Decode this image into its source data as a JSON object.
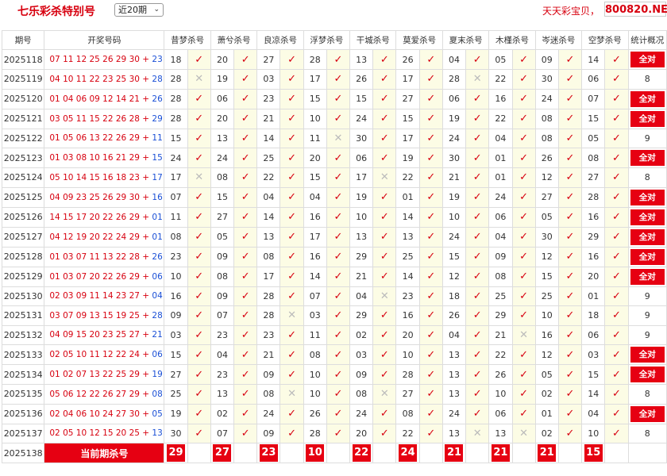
{
  "header": {
    "title": "七乐彩杀特别号",
    "period_select": "近20期",
    "slogan": "天天彩宝贝，",
    "site": "800820.NET"
  },
  "columns": [
    "期号",
    "开奖号码",
    "昔梦杀号",
    "萧兮杀号",
    "良凉杀号",
    "浮梦杀号",
    "干城杀号",
    "莫爱杀号",
    "夏末杀号",
    "木槿杀号",
    "岑迷杀号",
    "空梦杀号",
    "统计概况"
  ],
  "rows": [
    {
      "issue": "2025118",
      "draw": "07 11 12 25 26 29 30",
      "special": "23",
      "kills": [
        [
          "18",
          "hit"
        ],
        [
          "20",
          "hit"
        ],
        [
          "27",
          "hit"
        ],
        [
          "28",
          "hit"
        ],
        [
          "13",
          "hit"
        ],
        [
          "26",
          "hit"
        ],
        [
          "04",
          "hit"
        ],
        [
          "05",
          "hit"
        ],
        [
          "09",
          "hit"
        ],
        [
          "14",
          "hit"
        ]
      ],
      "stat": "全对"
    },
    {
      "issue": "2025119",
      "draw": "04 10 11 22 23 25 30",
      "special": "28",
      "kills": [
        [
          "28",
          "miss"
        ],
        [
          "19",
          "hit"
        ],
        [
          "03",
          "hit"
        ],
        [
          "17",
          "hit"
        ],
        [
          "26",
          "hit"
        ],
        [
          "17",
          "hit"
        ],
        [
          "28",
          "miss"
        ],
        [
          "22",
          "hit"
        ],
        [
          "30",
          "hit"
        ],
        [
          "06",
          "hit"
        ]
      ],
      "stat": "8"
    },
    {
      "issue": "2025120",
      "draw": "01 04 06 09 12 14 21",
      "special": "26",
      "kills": [
        [
          "28",
          "hit"
        ],
        [
          "06",
          "hit"
        ],
        [
          "23",
          "hit"
        ],
        [
          "15",
          "hit"
        ],
        [
          "15",
          "hit"
        ],
        [
          "27",
          "hit"
        ],
        [
          "06",
          "hit"
        ],
        [
          "16",
          "hit"
        ],
        [
          "24",
          "hit"
        ],
        [
          "07",
          "hit"
        ]
      ],
      "stat": "全对"
    },
    {
      "issue": "2025121",
      "draw": "03 05 11 15 22 26 28",
      "special": "29",
      "kills": [
        [
          "28",
          "hit"
        ],
        [
          "20",
          "hit"
        ],
        [
          "21",
          "hit"
        ],
        [
          "10",
          "hit"
        ],
        [
          "24",
          "hit"
        ],
        [
          "15",
          "hit"
        ],
        [
          "19",
          "hit"
        ],
        [
          "22",
          "hit"
        ],
        [
          "08",
          "hit"
        ],
        [
          "15",
          "hit"
        ]
      ],
      "stat": "全对"
    },
    {
      "issue": "2025122",
      "draw": "01 05 06 13 22 26 29",
      "special": "11",
      "kills": [
        [
          "15",
          "hit"
        ],
        [
          "13",
          "hit"
        ],
        [
          "14",
          "hit"
        ],
        [
          "11",
          "miss"
        ],
        [
          "30",
          "hit"
        ],
        [
          "17",
          "hit"
        ],
        [
          "24",
          "hit"
        ],
        [
          "04",
          "hit"
        ],
        [
          "08",
          "hit"
        ],
        [
          "05",
          "hit"
        ]
      ],
      "stat": "9"
    },
    {
      "issue": "2025123",
      "draw": "01 03 08 10 16 21 29",
      "special": "15",
      "kills": [
        [
          "24",
          "hit"
        ],
        [
          "24",
          "hit"
        ],
        [
          "25",
          "hit"
        ],
        [
          "20",
          "hit"
        ],
        [
          "06",
          "hit"
        ],
        [
          "19",
          "hit"
        ],
        [
          "30",
          "hit"
        ],
        [
          "01",
          "hit"
        ],
        [
          "26",
          "hit"
        ],
        [
          "08",
          "hit"
        ]
      ],
      "stat": "全对"
    },
    {
      "issue": "2025124",
      "draw": "05 10 14 15 16 18 23",
      "special": "17",
      "kills": [
        [
          "17",
          "miss"
        ],
        [
          "08",
          "hit"
        ],
        [
          "22",
          "hit"
        ],
        [
          "15",
          "hit"
        ],
        [
          "17",
          "miss"
        ],
        [
          "22",
          "hit"
        ],
        [
          "21",
          "hit"
        ],
        [
          "01",
          "hit"
        ],
        [
          "12",
          "hit"
        ],
        [
          "27",
          "hit"
        ]
      ],
      "stat": "8"
    },
    {
      "issue": "2025125",
      "draw": "04 09 23 25 26 29 30",
      "special": "16",
      "kills": [
        [
          "07",
          "hit"
        ],
        [
          "15",
          "hit"
        ],
        [
          "04",
          "hit"
        ],
        [
          "04",
          "hit"
        ],
        [
          "19",
          "hit"
        ],
        [
          "01",
          "hit"
        ],
        [
          "19",
          "hit"
        ],
        [
          "24",
          "hit"
        ],
        [
          "27",
          "hit"
        ],
        [
          "28",
          "hit"
        ]
      ],
      "stat": "全对"
    },
    {
      "issue": "2025126",
      "draw": "14 15 17 20 22 26 29",
      "special": "01",
      "kills": [
        [
          "11",
          "hit"
        ],
        [
          "27",
          "hit"
        ],
        [
          "14",
          "hit"
        ],
        [
          "16",
          "hit"
        ],
        [
          "10",
          "hit"
        ],
        [
          "14",
          "hit"
        ],
        [
          "10",
          "hit"
        ],
        [
          "06",
          "hit"
        ],
        [
          "05",
          "hit"
        ],
        [
          "16",
          "hit"
        ]
      ],
      "stat": "全对"
    },
    {
      "issue": "2025127",
      "draw": "04 12 19 20 22 24 29",
      "special": "01",
      "kills": [
        [
          "08",
          "hit"
        ],
        [
          "05",
          "hit"
        ],
        [
          "13",
          "hit"
        ],
        [
          "17",
          "hit"
        ],
        [
          "13",
          "hit"
        ],
        [
          "13",
          "hit"
        ],
        [
          "24",
          "hit"
        ],
        [
          "04",
          "hit"
        ],
        [
          "30",
          "hit"
        ],
        [
          "29",
          "hit"
        ]
      ],
      "stat": "全对"
    },
    {
      "issue": "2025128",
      "draw": "01 03 07 11 13 22 28",
      "special": "26",
      "kills": [
        [
          "23",
          "hit"
        ],
        [
          "09",
          "hit"
        ],
        [
          "08",
          "hit"
        ],
        [
          "16",
          "hit"
        ],
        [
          "29",
          "hit"
        ],
        [
          "25",
          "hit"
        ],
        [
          "15",
          "hit"
        ],
        [
          "09",
          "hit"
        ],
        [
          "12",
          "hit"
        ],
        [
          "16",
          "hit"
        ]
      ],
      "stat": "全对"
    },
    {
      "issue": "2025129",
      "draw": "01 03 07 20 22 26 29",
      "special": "06",
      "kills": [
        [
          "10",
          "hit"
        ],
        [
          "08",
          "hit"
        ],
        [
          "17",
          "hit"
        ],
        [
          "14",
          "hit"
        ],
        [
          "21",
          "hit"
        ],
        [
          "14",
          "hit"
        ],
        [
          "12",
          "hit"
        ],
        [
          "08",
          "hit"
        ],
        [
          "15",
          "hit"
        ],
        [
          "20",
          "hit"
        ]
      ],
      "stat": "全对"
    },
    {
      "issue": "2025130",
      "draw": "02 03 09 11 14 23 27",
      "special": "04",
      "kills": [
        [
          "16",
          "hit"
        ],
        [
          "09",
          "hit"
        ],
        [
          "28",
          "hit"
        ],
        [
          "07",
          "hit"
        ],
        [
          "04",
          "miss"
        ],
        [
          "23",
          "hit"
        ],
        [
          "18",
          "hit"
        ],
        [
          "25",
          "hit"
        ],
        [
          "25",
          "hit"
        ],
        [
          "01",
          "hit"
        ]
      ],
      "stat": "9"
    },
    {
      "issue": "2025131",
      "draw": "03 07 09 13 15 19 25",
      "special": "28",
      "kills": [
        [
          "09",
          "hit"
        ],
        [
          "07",
          "hit"
        ],
        [
          "28",
          "miss"
        ],
        [
          "03",
          "hit"
        ],
        [
          "29",
          "hit"
        ],
        [
          "16",
          "hit"
        ],
        [
          "26",
          "hit"
        ],
        [
          "29",
          "hit"
        ],
        [
          "10",
          "hit"
        ],
        [
          "18",
          "hit"
        ]
      ],
      "stat": "9"
    },
    {
      "issue": "2025132",
      "draw": "04 09 15 20 23 25 27",
      "special": "21",
      "kills": [
        [
          "03",
          "hit"
        ],
        [
          "23",
          "hit"
        ],
        [
          "23",
          "hit"
        ],
        [
          "11",
          "hit"
        ],
        [
          "02",
          "hit"
        ],
        [
          "20",
          "hit"
        ],
        [
          "04",
          "hit"
        ],
        [
          "21",
          "miss"
        ],
        [
          "16",
          "hit"
        ],
        [
          "06",
          "hit"
        ]
      ],
      "stat": "9"
    },
    {
      "issue": "2025133",
      "draw": "02 05 10 11 12 22 24",
      "special": "06",
      "kills": [
        [
          "15",
          "hit"
        ],
        [
          "04",
          "hit"
        ],
        [
          "21",
          "hit"
        ],
        [
          "08",
          "hit"
        ],
        [
          "03",
          "hit"
        ],
        [
          "10",
          "hit"
        ],
        [
          "13",
          "hit"
        ],
        [
          "22",
          "hit"
        ],
        [
          "12",
          "hit"
        ],
        [
          "03",
          "hit"
        ]
      ],
      "stat": "全对"
    },
    {
      "issue": "2025134",
      "draw": "01 02 07 13 22 25 29",
      "special": "19",
      "kills": [
        [
          "27",
          "hit"
        ],
        [
          "23",
          "hit"
        ],
        [
          "09",
          "hit"
        ],
        [
          "10",
          "hit"
        ],
        [
          "09",
          "hit"
        ],
        [
          "28",
          "hit"
        ],
        [
          "13",
          "hit"
        ],
        [
          "26",
          "hit"
        ],
        [
          "05",
          "hit"
        ],
        [
          "15",
          "hit"
        ]
      ],
      "stat": "全对"
    },
    {
      "issue": "2025135",
      "draw": "05 06 12 22 26 27 29",
      "special": "08",
      "kills": [
        [
          "25",
          "hit"
        ],
        [
          "13",
          "hit"
        ],
        [
          "08",
          "miss"
        ],
        [
          "10",
          "hit"
        ],
        [
          "08",
          "miss"
        ],
        [
          "27",
          "hit"
        ],
        [
          "13",
          "hit"
        ],
        [
          "10",
          "hit"
        ],
        [
          "02",
          "hit"
        ],
        [
          "14",
          "hit"
        ]
      ],
      "stat": "8"
    },
    {
      "issue": "2025136",
      "draw": "02 04 06 10 24 27 30",
      "special": "05",
      "kills": [
        [
          "19",
          "hit"
        ],
        [
          "02",
          "hit"
        ],
        [
          "24",
          "hit"
        ],
        [
          "26",
          "hit"
        ],
        [
          "24",
          "hit"
        ],
        [
          "08",
          "hit"
        ],
        [
          "24",
          "hit"
        ],
        [
          "06",
          "hit"
        ],
        [
          "01",
          "hit"
        ],
        [
          "04",
          "hit"
        ]
      ],
      "stat": "全对"
    },
    {
      "issue": "2025137",
      "draw": "02 05 10 12 15 20 25",
      "special": "13",
      "kills": [
        [
          "30",
          "hit"
        ],
        [
          "07",
          "hit"
        ],
        [
          "09",
          "hit"
        ],
        [
          "28",
          "hit"
        ],
        [
          "20",
          "hit"
        ],
        [
          "22",
          "hit"
        ],
        [
          "13",
          "miss"
        ],
        [
          "13",
          "miss"
        ],
        [
          "02",
          "hit"
        ],
        [
          "10",
          "hit"
        ]
      ],
      "stat": "8"
    }
  ],
  "current": {
    "issue": "2025138",
    "label": "当前期杀号",
    "values": [
      "29",
      "27",
      "23",
      "10",
      "22",
      "24",
      "21",
      "21",
      "21",
      "15"
    ]
  },
  "symbols": {
    "hit": "✓",
    "miss": "✕"
  },
  "colors": {
    "red": "#e60012",
    "blue": "#1a4fd6",
    "cell_bg": "#fcfce5"
  }
}
